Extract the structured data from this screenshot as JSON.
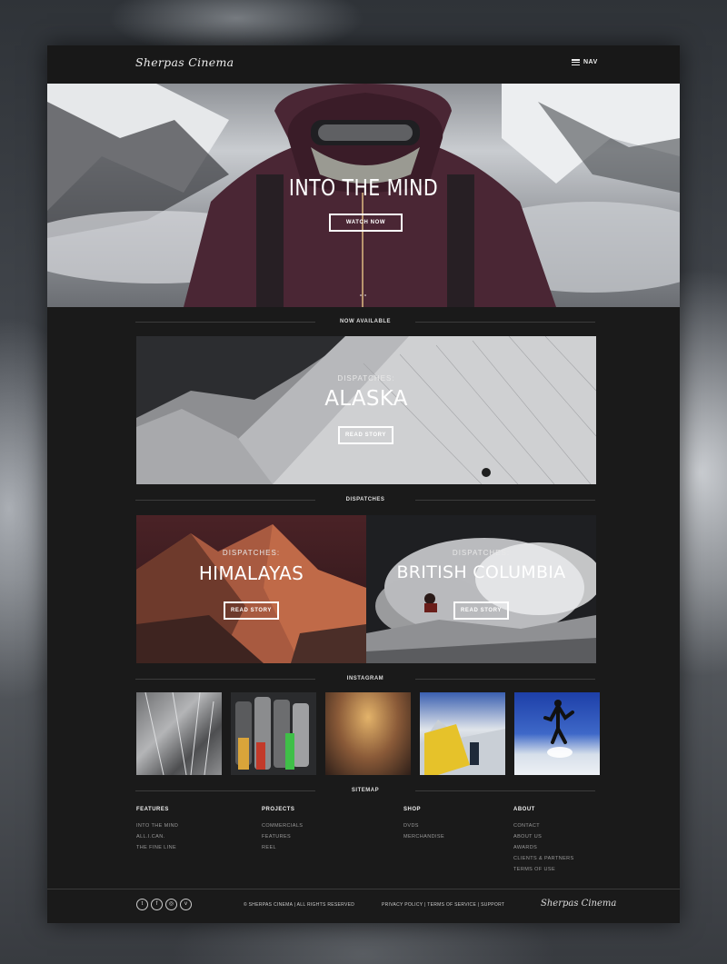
{
  "header": {
    "logo": "Sherpas Cinema",
    "nav_label": "NAV"
  },
  "hero": {
    "title": "INTO THE MIND",
    "button": "WATCH NOW"
  },
  "sections": {
    "now_available": "NOW AVAILABLE",
    "dispatches": "DISPATCHES",
    "instagram": "INSTAGRAM",
    "sitemap": "SITEMAP"
  },
  "feature": {
    "kicker": "DISPATCHES:",
    "title": "ALASKA",
    "button": "READ STORY"
  },
  "dispatch_cards": [
    {
      "kicker": "DISPATCHES:",
      "title": "HIMALAYAS",
      "button": "READ STORY"
    },
    {
      "kicker": "DISPATCHES:",
      "title": "BRITISH COLUMBIA",
      "button": "READ STORY"
    }
  ],
  "sitemap": [
    {
      "title": "FEATURES",
      "links": [
        "INTO THE MIND",
        "ALL.I.CAN.",
        "THE FINE LINE"
      ]
    },
    {
      "title": "PROJECTS",
      "links": [
        "COMMERCIALS",
        "FEATURES",
        "REEL"
      ]
    },
    {
      "title": "SHOP",
      "links": [
        "DVDS",
        "MERCHANDISE"
      ]
    },
    {
      "title": "ABOUT",
      "links": [
        "CONTACT",
        "ABOUT US",
        "AWARDS",
        "CLIENTS & PARTNERS",
        "TERMS OF USE"
      ]
    }
  ],
  "footer": {
    "social_icons": [
      "twitter-icon",
      "facebook-icon",
      "instagram-icon",
      "vimeo-icon"
    ],
    "social_glyphs": [
      "t",
      "f",
      "◎",
      "v"
    ],
    "copyright": "© SHERPAS CINEMA | ALL RIGHTS RESERVED",
    "privacy": "PRIVACY POLICY",
    "terms": "TERMS OF SERVICE",
    "support": "SUPPORT",
    "sep": " | ",
    "logo": "Sherpas Cinema"
  },
  "colors": {
    "page_bg": "#1a1a1a",
    "accent_text": "#ffffff",
    "muted_text": "#999999"
  }
}
